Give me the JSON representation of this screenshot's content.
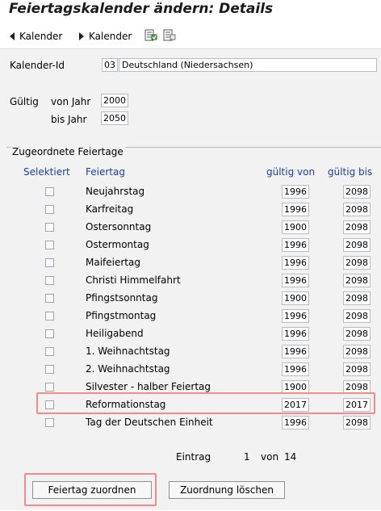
{
  "window": {
    "title": "Feiertagskalender ändern: Details"
  },
  "toolbar": {
    "prev_label": "Kalender",
    "next_label": "Kalender"
  },
  "calendar": {
    "label": "Kalender-Id",
    "id": "03",
    "name": "Deutschland (Niedersachsen)"
  },
  "validity": {
    "label": "Gültig",
    "from_label": "von Jahr",
    "from_value": "2000",
    "to_label": "bis Jahr",
    "to_value": "2050"
  },
  "holidays": {
    "group_title": "Zugeordnete Feiertage",
    "headers": {
      "selected": "Selektiert",
      "name": "Feiertag",
      "valid_from": "gültig von",
      "valid_to": "gültig bis"
    },
    "rows": [
      {
        "name": "Neujahrstag",
        "from": "1996",
        "to": "2098"
      },
      {
        "name": "Karfreitag",
        "from": "1996",
        "to": "2098"
      },
      {
        "name": "Ostersonntag",
        "from": "1900",
        "to": "2098"
      },
      {
        "name": "Ostermontag",
        "from": "1996",
        "to": "2098"
      },
      {
        "name": "Maifeiertag",
        "from": "1996",
        "to": "2098"
      },
      {
        "name": "Christi Himmelfahrt",
        "from": "1996",
        "to": "2098"
      },
      {
        "name": "Pfingstsonntag",
        "from": "1900",
        "to": "2098"
      },
      {
        "name": "Pfingstmontag",
        "from": "1996",
        "to": "2098"
      },
      {
        "name": "Heiligabend",
        "from": "1996",
        "to": "2098"
      },
      {
        "name": "1. Weihnachtstag",
        "from": "1996",
        "to": "2098"
      },
      {
        "name": "2. Weihnachtstag",
        "from": "1996",
        "to": "2098"
      },
      {
        "name": "Silvester - halber Feiertag",
        "from": "1900",
        "to": "2098"
      },
      {
        "name": "Reformationstag",
        "from": "2017",
        "to": "2017"
      },
      {
        "name": "Tag der Deutschen Einheit",
        "from": "1996",
        "to": "2098"
      }
    ],
    "pager": {
      "label": "Eintrag",
      "current": "1",
      "of_label": "von",
      "total": "14"
    }
  },
  "buttons": {
    "assign": "Feiertag zuordnen",
    "delete": "Zuordnung löschen"
  },
  "colors": {
    "highlight": "#f28b8b",
    "header_blue": "#1c3fa0"
  }
}
